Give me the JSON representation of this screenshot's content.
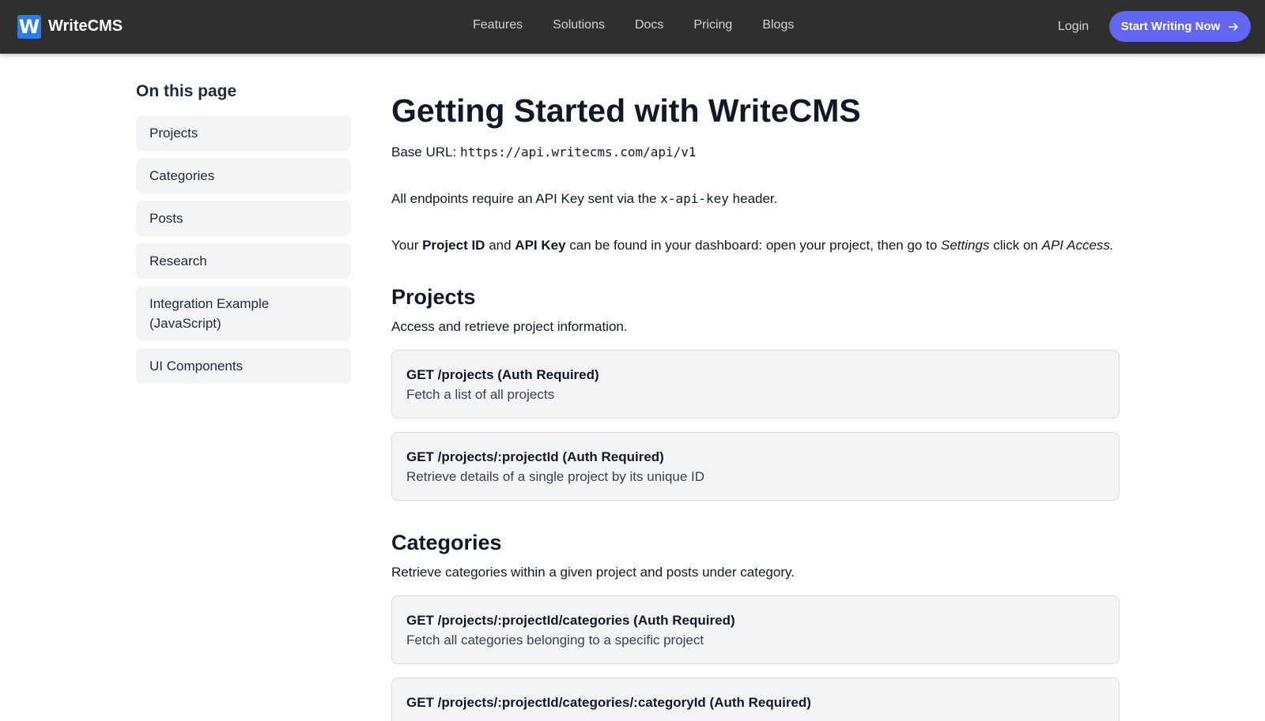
{
  "brand": {
    "logo_letter": "W",
    "name": "WriteCMS",
    "logo_color": "#2b7de9"
  },
  "nav": {
    "links": [
      "Features",
      "Solutions",
      "Docs",
      "Pricing",
      "Blogs"
    ],
    "login": "Login",
    "cta": "Start Writing Now",
    "cta_color": "#6366f1"
  },
  "sidebar": {
    "title": "On this page",
    "items": [
      "Projects",
      "Categories",
      "Posts",
      "Research",
      "Integration Example (JavaScript)",
      "UI Components"
    ]
  },
  "main": {
    "title": "Getting Started with WriteCMS",
    "base_url_label": "Base URL:",
    "base_url": "https://api.writecms.com/api/v1",
    "auth_prefix": "All endpoints require an API Key sent via the",
    "auth_header": "x-api-key",
    "auth_suffix": "header.",
    "keys_your": "Your",
    "keys_project_id": "Project ID",
    "keys_and": "and",
    "keys_api_key": "API Key",
    "keys_text": "can be found in your dashboard: open your project, then go to",
    "keys_settings": "Settings",
    "keys_click": "click on",
    "keys_api_access": "API Access.",
    "sections": [
      {
        "heading": "Projects",
        "description": "Access and retrieve project information.",
        "endpoints": [
          {
            "title": "GET /projects (Auth Required)",
            "desc": "Fetch a list of all projects"
          },
          {
            "title": "GET /projects/:projectId (Auth Required)",
            "desc": "Retrieve details of a single project by its unique ID"
          }
        ]
      },
      {
        "heading": "Categories",
        "description": "Retrieve categories within a given project and posts under category.",
        "endpoints": [
          {
            "title": "GET /projects/:projectId/categories (Auth Required)",
            "desc": "Fetch all categories belonging to a specific project"
          },
          {
            "title": "GET /projects/:projectId/categories/:categoryId (Auth Required)",
            "desc": ""
          }
        ]
      }
    ]
  }
}
